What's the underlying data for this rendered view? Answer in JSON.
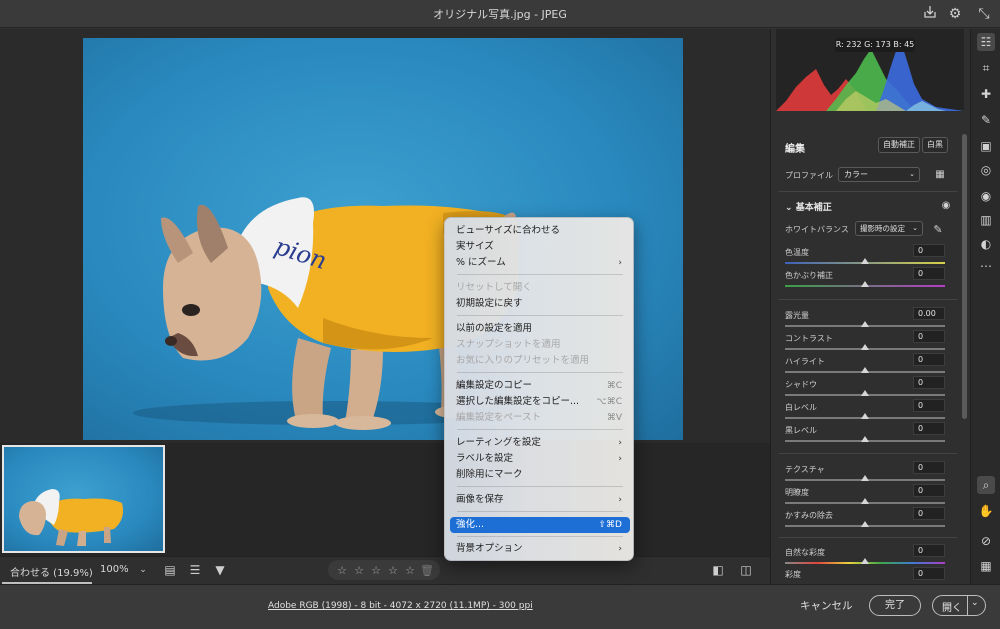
{
  "window": {
    "title": "オリジナル写真.jpg - JPEG"
  },
  "icons": {
    "export": "export-icon",
    "settings": "gear-icon",
    "collapse": "collapse-icon"
  },
  "bottombar": {
    "zoom_fit": "合わせる (19.9%)",
    "zoom_100": "100%",
    "stars": [
      "☆",
      "☆",
      "☆",
      "☆",
      "☆"
    ]
  },
  "status": {
    "info": "Adobe RGB (1998) - 8 bit - 4072 x 2720 (11.1MP) - 300 ppi",
    "cancel": "キャンセル",
    "done": "完了",
    "open": "開く"
  },
  "histogram": {
    "readout": "R: 232  G: 173  B: 45",
    "colors": {
      "red": "#e23b3b",
      "green": "#4fc24f",
      "blue": "#3d6be0"
    }
  },
  "edit": {
    "title": "編集",
    "auto": "自動補正",
    "bw": "白黒",
    "profile_label": "プロファイル",
    "profile_value": "カラー",
    "basic_title": "基本補正",
    "wb_label": "ホワイトバランス",
    "wb_value": "撮影時の設定",
    "sliders": [
      {
        "label": "色温度",
        "value": "0"
      },
      {
        "label": "色かぶり補正",
        "value": "0"
      },
      {
        "label": "露光量",
        "value": "0.00"
      },
      {
        "label": "コントラスト",
        "value": "0"
      },
      {
        "label": "ハイライト",
        "value": "0"
      },
      {
        "label": "シャドウ",
        "value": "0"
      },
      {
        "label": "白レベル",
        "value": "0"
      },
      {
        "label": "黒レベル",
        "value": "0"
      },
      {
        "label": "テクスチャ",
        "value": "0"
      },
      {
        "label": "明瞭度",
        "value": "0"
      },
      {
        "label": "かすみの除去",
        "value": "0"
      },
      {
        "label": "自然な彩度",
        "value": "0"
      },
      {
        "label": "彩度",
        "value": "0"
      }
    ]
  },
  "photo": {
    "hood_text": "pion"
  },
  "context_menu": {
    "items": [
      {
        "label": "ビューサイズに合わせる",
        "shortcut": "",
        "submenu": false,
        "disabled": false
      },
      {
        "label": "実サイズ",
        "shortcut": "",
        "submenu": false,
        "disabled": false
      },
      {
        "label": "% にズーム",
        "shortcut": "",
        "submenu": true,
        "disabled": false
      },
      {
        "label": "リセットして開く",
        "shortcut": "",
        "submenu": false,
        "disabled": true
      },
      {
        "label": "初期設定に戻す",
        "shortcut": "",
        "submenu": false,
        "disabled": false
      },
      {
        "label": "以前の設定を適用",
        "shortcut": "",
        "submenu": false,
        "disabled": false
      },
      {
        "label": "スナップショットを適用",
        "shortcut": "",
        "submenu": false,
        "disabled": true
      },
      {
        "label": "お気に入りのプリセットを適用",
        "shortcut": "",
        "submenu": false,
        "disabled": true
      },
      {
        "label": "編集設定のコピー",
        "shortcut": "⌘C",
        "submenu": false,
        "disabled": false
      },
      {
        "label": "選択した編集設定をコピー...",
        "shortcut": "⌥⌘C",
        "submenu": false,
        "disabled": false
      },
      {
        "label": "編集設定をペースト",
        "shortcut": "⌘V",
        "submenu": false,
        "disabled": true
      },
      {
        "label": "レーティングを設定",
        "shortcut": "",
        "submenu": true,
        "disabled": false
      },
      {
        "label": "ラベルを設定",
        "shortcut": "",
        "submenu": true,
        "disabled": false
      },
      {
        "label": "削除用にマーク",
        "shortcut": "",
        "submenu": false,
        "disabled": false
      },
      {
        "label": "画像を保存",
        "shortcut": "",
        "submenu": true,
        "disabled": false
      },
      {
        "label": "強化...",
        "shortcut": "⇧⌘D",
        "submenu": false,
        "disabled": false,
        "highlighted": true
      },
      {
        "label": "背景オプション",
        "shortcut": "",
        "submenu": true,
        "disabled": false
      }
    ]
  },
  "toolstrip": [
    "sliders-icon",
    "crop-icon",
    "heal-icon",
    "brush-icon",
    "gradient-icon",
    "radial-icon",
    "redeye-icon",
    "snapshot-icon",
    "presets-icon",
    "more-icon",
    "zoom-icon",
    "hand-icon",
    "eyedropper-icon",
    "grid-icon"
  ]
}
